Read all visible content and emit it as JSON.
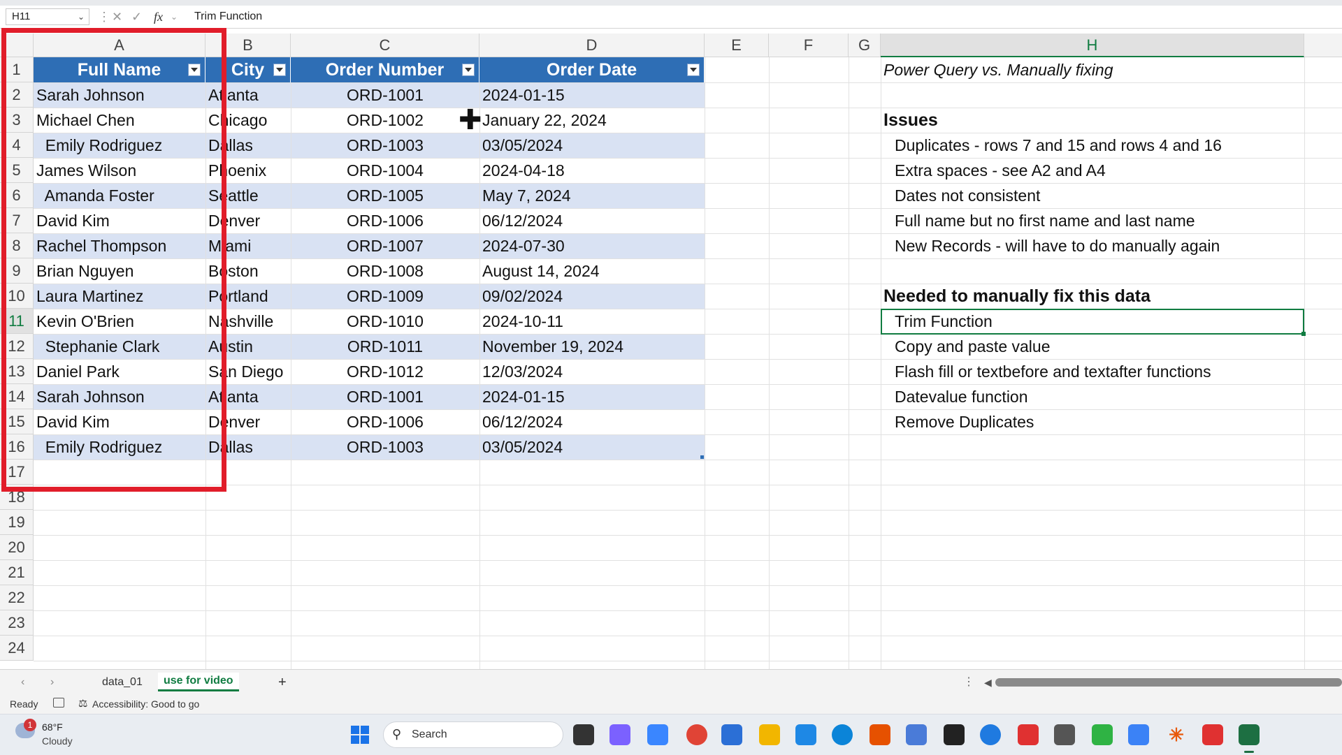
{
  "formula_bar": {
    "name_box": "H11",
    "fx": "fx",
    "content": "Trim Function"
  },
  "columns": [
    "A",
    "B",
    "C",
    "D",
    "E",
    "F",
    "G",
    "H"
  ],
  "rows": [
    "1",
    "2",
    "3",
    "4",
    "5",
    "6",
    "7",
    "8",
    "9",
    "10",
    "11",
    "12",
    "13",
    "14",
    "15",
    "16",
    "17",
    "18",
    "19",
    "20",
    "21",
    "22",
    "23",
    "24"
  ],
  "table": {
    "headers": [
      "Full Name",
      "City",
      "Order Number",
      "Order Date"
    ],
    "rows": [
      [
        "Sarah Johnson",
        "Atlanta",
        "ORD-1001",
        "2024-01-15"
      ],
      [
        "Michael Chen",
        "Chicago",
        "ORD-1002",
        "January 22, 2024"
      ],
      [
        "  Emily Rodriguez",
        "Dallas",
        "ORD-1003",
        "03/05/2024"
      ],
      [
        "James Wilson",
        "Phoenix",
        "ORD-1004",
        "2024-04-18"
      ],
      [
        "  Amanda Foster",
        "Seattle",
        "ORD-1005",
        "May 7, 2024"
      ],
      [
        "David Kim",
        "Denver",
        "ORD-1006",
        "06/12/2024"
      ],
      [
        "Rachel Thompson",
        "Miami",
        "ORD-1007",
        "2024-07-30"
      ],
      [
        "Brian Nguyen",
        "Boston",
        "ORD-1008",
        "August 14, 2024"
      ],
      [
        "Laura Martinez",
        "Portland",
        "ORD-1009",
        "09/02/2024"
      ],
      [
        "Kevin O'Brien",
        "Nashville",
        "ORD-1010",
        "2024-10-11"
      ],
      [
        "  Stephanie Clark",
        "Austin",
        "ORD-1011",
        "November 19, 2024"
      ],
      [
        "Daniel Park",
        "San Diego",
        "ORD-1012",
        "12/03/2024"
      ],
      [
        "Sarah Johnson",
        "Atlanta",
        "ORD-1001",
        "2024-01-15"
      ],
      [
        "David Kim",
        "Denver",
        "ORD-1006",
        "06/12/2024"
      ],
      [
        "  Emily Rodriguez",
        "Dallas",
        "ORD-1003",
        "03/05/2024"
      ]
    ]
  },
  "notes": {
    "title": "Power Query vs. Manually fixing",
    "issues_heading": "Issues",
    "issues": [
      "Duplicates - rows 7 and 15 and rows 4 and 16",
      "Extra spaces - see A2 and A4",
      "Dates not consistent",
      "Full name but no first name and last name",
      "New Records - will have to do manually again"
    ],
    "fix_heading": "Needed to manually fix this data",
    "fixes": [
      "Trim Function",
      "Copy and paste value",
      "Flash fill or textbefore and textafter functions",
      "Datevalue function",
      "Remove Duplicates"
    ]
  },
  "sheet_tabs": {
    "tab1": "data_01",
    "tab2": "use for video",
    "add": "+"
  },
  "status": {
    "ready": "Ready",
    "accessibility": "Accessibility: Good to go"
  },
  "taskbar": {
    "weather_temp": "68°F",
    "weather_desc": "Cloudy",
    "weather_badge": "1",
    "search": "Search"
  },
  "colors": {
    "accent": "#107c41",
    "table_header": "#2e6eb5",
    "band": "#d9e2f3",
    "highlight": "#e11d2a"
  }
}
